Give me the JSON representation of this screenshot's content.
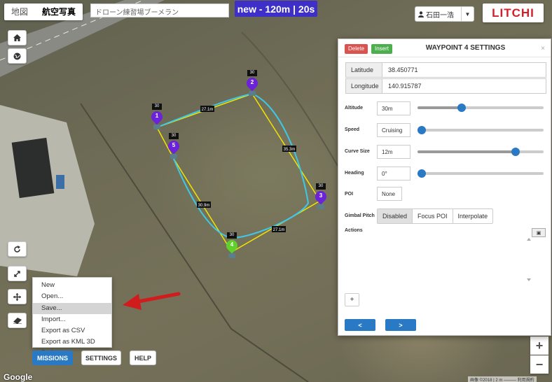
{
  "maptype": {
    "map_label": "地図",
    "satellite_label": "航空写真"
  },
  "mission": {
    "name": "ドローン練習場ブーメラン"
  },
  "stats": {
    "label": "new - 120m | 20s"
  },
  "user": {
    "name": "石田一浩"
  },
  "logo": {
    "text": "LITCHI"
  },
  "waypoints": [
    {
      "number": "1",
      "altitude_tag": "30",
      "color": "#6b22d8"
    },
    {
      "number": "2",
      "altitude_tag": "30",
      "color": "#6b22d8"
    },
    {
      "number": "3",
      "altitude_tag": "30",
      "color": "#6b22d8"
    },
    {
      "number": "4",
      "altitude_tag": "30",
      "color": "#5fd12b"
    },
    {
      "number": "5",
      "altitude_tag": "30",
      "color": "#6b22d8"
    }
  ],
  "distances": [
    "27.1m",
    "35.3m",
    "27.1m",
    "30.9m"
  ],
  "menu": {
    "items": [
      "New",
      "Open...",
      "Save...",
      "Import...",
      "Export as CSV",
      "Export as KML 3D Path"
    ],
    "highlighted": "Save..."
  },
  "bottom": {
    "missions": "MISSIONS",
    "settings": "SETTINGS",
    "help": "HELP"
  },
  "google": "Google",
  "copyright": "画像 ©2018 | 2 m ——— 利用規約",
  "panel": {
    "delete_label": "Delete",
    "insert_label": "Insert",
    "title": "WAYPOINT 4 SETTINGS",
    "close": "×",
    "latitude_label": "Latitude",
    "latitude": "38.450771",
    "longitude_label": "Longitude",
    "longitude": "140.915787",
    "altitude_label": "Altitude",
    "altitude": "30m",
    "altitude_level": 0.34,
    "speed_label": "Speed",
    "speed": "Cruising",
    "speed_level": 0,
    "curve_label": "Curve Size",
    "curve": "12m",
    "curve_level": 0.8,
    "heading_label": "Heading",
    "heading": "0°",
    "heading_level": 0,
    "poi_label": "POI",
    "poi": "None",
    "gimbal_label": "Gimbal Pitch",
    "gimbal_options": [
      "Disabled",
      "Focus POI",
      "Interpolate"
    ],
    "gimbal_selected": "Disabled",
    "actions_label": "Actions",
    "add_label": "+",
    "prev_label": "<",
    "next_label": ">"
  },
  "colors": {
    "accent": "#2a79c4",
    "stats_bg": "#3d2fc8",
    "delete": "#d9534f",
    "insert": "#4cae4c",
    "route": "#f2e400",
    "curve": "#3cc9e8"
  }
}
